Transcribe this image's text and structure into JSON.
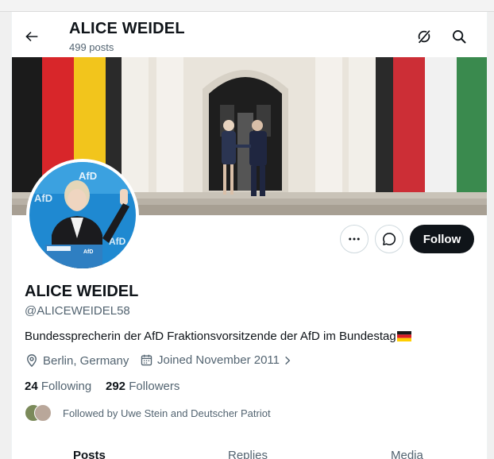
{
  "header": {
    "name": "ALICE WEIDEL",
    "posts": "499 posts"
  },
  "profile": {
    "display_name": "ALICE WEIDEL",
    "handle": "@ALICEWEIDEL58",
    "bio": "Bundessprecherin der AfD Fraktionsvorsitzende der AfD im Bundestag",
    "location": "Berlin, Germany",
    "joined": "Joined November 2011",
    "following_count": "24",
    "following_label": "Following",
    "followers_count": "292",
    "followers_label": "Followers",
    "followed_by": "Followed by Uwe Stein and Deutscher Patriot"
  },
  "buttons": {
    "follow": "Follow"
  },
  "tabs": [
    "Posts",
    "Replies",
    "Media"
  ],
  "colors": {
    "follow_bg": "#0f1419",
    "secondary_text": "#536471",
    "border": "#cfd9de"
  },
  "icons": [
    "back-arrow-icon",
    "grok-icon",
    "search-icon",
    "more-icon",
    "message-icon",
    "location-icon",
    "calendar-icon",
    "chevron-right-icon",
    "german-flag-emoji"
  ]
}
